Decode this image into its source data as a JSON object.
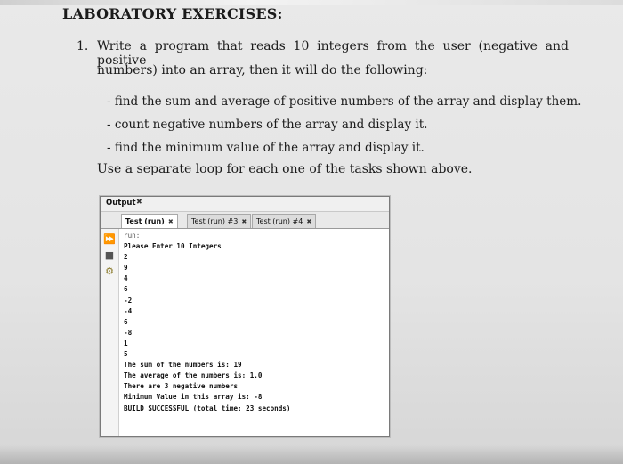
{
  "document": {
    "heading": "LABORATORY EXERCISES:",
    "question": {
      "number": "1.",
      "line1": "Write a program that reads 10 integers from the user (negative and positive",
      "line2": "numbers) into an array, then it will do the following:",
      "bullets": [
        "- find the sum and average of positive numbers of the array and display them.",
        "- count negative numbers of the array and display it.",
        "- find the minimum value of the array and display it."
      ],
      "note": "Use a separate loop for each one of the tasks shown above."
    }
  },
  "output_window": {
    "title": "Output",
    "tabs": [
      {
        "label": "Test (run)",
        "active": true
      },
      {
        "label": "Test (run) #3",
        "active": false
      },
      {
        "label": "Test (run) #4",
        "active": false
      }
    ],
    "gutter_icons": [
      "run-again-icon",
      "stop-icon",
      "settings-icon"
    ],
    "console_lines": [
      "run:",
      "Please Enter 10 Integers",
      "2",
      "9",
      "4",
      "6",
      "-2",
      "-4",
      "6",
      "-8",
      "1",
      "5",
      "The sum of the numbers is: 19",
      "The average of the numbers is: 1.0",
      "There are 3 negative numbers",
      "Minimum Value in this array is: -8",
      "BUILD SUCCESSFUL (total time: 23 seconds)"
    ]
  }
}
